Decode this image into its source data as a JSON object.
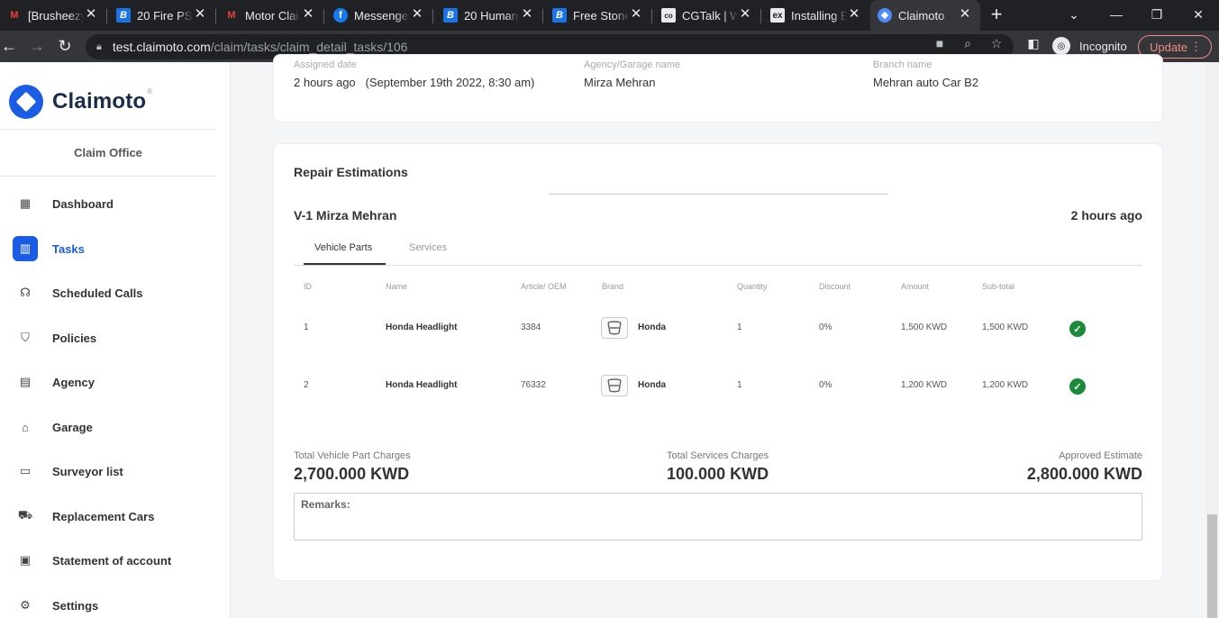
{
  "browser": {
    "tabs": [
      {
        "title": "[Brusheezy",
        "icon": "gmail-icon",
        "color": "#ea4335"
      },
      {
        "title": "20 Fire PS",
        "icon": "brusheezy-icon",
        "color": "#1a73e8"
      },
      {
        "title": "Motor Clai",
        "icon": "gmail-icon",
        "color": "#ea4335"
      },
      {
        "title": "Messenger",
        "icon": "facebook-icon",
        "color": "#1877f2"
      },
      {
        "title": "20 Human",
        "icon": "brusheezy-icon",
        "color": "#1a73e8"
      },
      {
        "title": "Free Stone",
        "icon": "brusheezy-icon",
        "color": "#1a73e8"
      },
      {
        "title": "CGTalk | W",
        "icon": "cgtalk-icon",
        "color": "#e8eaed"
      },
      {
        "title": "Installing E",
        "icon": "ex-icon",
        "color": "#e8eaed"
      },
      {
        "title": "Claimoto",
        "icon": "claimoto-icon",
        "color": "#4f8bf9"
      }
    ],
    "url_host": "test.claimoto.com",
    "url_path": "/claim/tasks/claim_detail_tasks/106",
    "incognito_label": "Incognito",
    "update_label": "Update"
  },
  "sidebar": {
    "logo_text": "Claimoto",
    "logo_reg": "®",
    "office": "Claim Office",
    "items": [
      {
        "label": "Dashboard",
        "icon": "dashboard-icon",
        "glyph": "▦"
      },
      {
        "label": "Tasks",
        "icon": "tasks-icon",
        "glyph": "▥"
      },
      {
        "label": "Scheduled Calls",
        "icon": "headset-icon",
        "glyph": "☊"
      },
      {
        "label": "Policies",
        "icon": "shield-icon",
        "glyph": "⛉"
      },
      {
        "label": "Agency",
        "icon": "building-icon",
        "glyph": "▤"
      },
      {
        "label": "Garage",
        "icon": "garage-icon",
        "glyph": "⌂"
      },
      {
        "label": "Surveyor list",
        "icon": "id-card-icon",
        "glyph": "▭"
      },
      {
        "label": "Replacement Cars",
        "icon": "car-icon",
        "glyph": "⛟"
      },
      {
        "label": "Statement of account",
        "icon": "document-icon",
        "glyph": "▣"
      },
      {
        "label": "Settings",
        "icon": "gear-icon",
        "glyph": "⚙"
      }
    ]
  },
  "top_card": {
    "fields": [
      {
        "label": "Assigned date",
        "value": "2 hours ago   (September 19th 2022, 8:30 am)"
      },
      {
        "label": "Agency/Garage name",
        "value": "Mirza Mehran"
      },
      {
        "label": "Branch name",
        "value": "Mehran auto Car B2"
      }
    ]
  },
  "repair": {
    "title": "Repair Estimations",
    "vehicle": "V-1 Mirza Mehran",
    "time": "2 hours ago",
    "tabs": [
      "Vehicle Parts",
      "Services"
    ],
    "columns": [
      "ID",
      "Name",
      "Article/ OEM",
      "Brand",
      "Quantity",
      "Discount",
      "Amount",
      "Sub-total"
    ],
    "rows": [
      {
        "id": "1",
        "name": "Honda Headlight",
        "oem": "3384",
        "brand": "Honda",
        "qty": "1",
        "discount": "0%",
        "amount": "1,500 KWD",
        "subtotal": "1,500 KWD"
      },
      {
        "id": "2",
        "name": "Honda Headlight",
        "oem": "76332",
        "brand": "Honda",
        "qty": "1",
        "discount": "0%",
        "amount": "1,200 KWD",
        "subtotal": "1,200 KWD"
      }
    ],
    "totals": {
      "parts_label": "Total Vehicle Part Charges",
      "parts_value": "2,700.000 KWD",
      "services_label": "Total Services Charges",
      "services_value": "100.000 KWD",
      "approved_label": "Approved Estimate",
      "approved_value": "2,800.000 KWD"
    },
    "remarks_label": "Remarks:"
  }
}
